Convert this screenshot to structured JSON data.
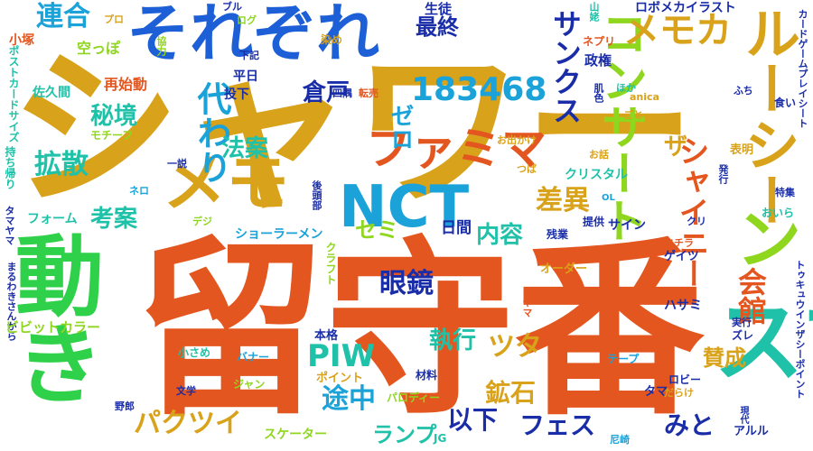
{
  "colors": {
    "orange": "#e4561f",
    "gold": "#d9a21b",
    "blue": "#1c5fd6",
    "sky": "#1ba3d9",
    "green": "#2fd14a",
    "lime": "#8fd61f",
    "teal": "#1fc2a8",
    "navy": "#1a2da8"
  },
  "words": [
    {
      "text": "留守番",
      "color": "orange"
    },
    {
      "text": "シャワー",
      "color": "gold"
    },
    {
      "text": "それぞれ",
      "color": "blue"
    },
    {
      "text": "動き",
      "color": "green"
    },
    {
      "text": "NCT",
      "color": "sky"
    },
    {
      "text": "ファミマ",
      "color": "orange"
    },
    {
      "text": "メモ",
      "color": "gold"
    },
    {
      "text": "ルーシー",
      "color": "gold"
    },
    {
      "text": "183468",
      "color": "sky"
    },
    {
      "text": "サンクス",
      "color": "navy"
    },
    {
      "text": "コンサート",
      "color": "lime"
    },
    {
      "text": "メモカ",
      "color": "gold"
    },
    {
      "text": "ザ",
      "color": "gold"
    },
    {
      "text": "ン",
      "color": "lime"
    },
    {
      "text": "シャイニー",
      "color": "orange"
    },
    {
      "text": "スマホ",
      "color": "teal"
    },
    {
      "text": "会館",
      "color": "orange"
    },
    {
      "text": "連合",
      "color": "sky"
    },
    {
      "text": "最終",
      "color": "navy"
    },
    {
      "text": "倉戸",
      "color": "navy"
    },
    {
      "text": "ゼロ",
      "color": "sky"
    },
    {
      "text": "秘境",
      "color": "teal"
    },
    {
      "text": "拡散",
      "color": "teal"
    },
    {
      "text": "代わり",
      "color": "sky"
    },
    {
      "text": "法案",
      "color": "teal"
    },
    {
      "text": "考案",
      "color": "teal"
    },
    {
      "text": "差異",
      "color": "gold"
    },
    {
      "text": "内容",
      "color": "teal"
    },
    {
      "text": "セミ",
      "color": "lime"
    },
    {
      "text": "眼鏡",
      "color": "navy"
    },
    {
      "text": "PIW",
      "color": "teal"
    },
    {
      "text": "執行",
      "color": "teal"
    },
    {
      "text": "ツタ",
      "color": "gold"
    },
    {
      "text": "鉱石",
      "color": "gold"
    },
    {
      "text": "途中",
      "color": "sky"
    },
    {
      "text": "以下",
      "color": "navy"
    },
    {
      "text": "フェス",
      "color": "navy"
    },
    {
      "text": "みと",
      "color": "navy"
    },
    {
      "text": "パクツイ",
      "color": "gold"
    },
    {
      "text": "ランプ",
      "color": "teal"
    },
    {
      "text": "賛成",
      "color": "gold"
    },
    {
      "text": "日間",
      "color": "navy"
    },
    {
      "text": "生徒",
      "color": "navy"
    },
    {
      "text": "山姥",
      "color": "teal"
    },
    {
      "text": "ロボメカイラスト",
      "color": "navy"
    },
    {
      "text": "ブル",
      "color": "navy"
    },
    {
      "text": "ログ",
      "color": "lime"
    },
    {
      "text": "プロ",
      "color": "gold"
    },
    {
      "text": "小塚",
      "color": "orange"
    },
    {
      "text": "空っぽ",
      "color": "lime"
    },
    {
      "text": "協力",
      "color": "lime"
    },
    {
      "text": "下記",
      "color": "navy"
    },
    {
      "text": "染め",
      "color": "gold"
    },
    {
      "text": "ネプリ",
      "color": "orange"
    },
    {
      "text": "政権",
      "color": "navy"
    },
    {
      "text": "平日",
      "color": "navy"
    },
    {
      "text": "投下",
      "color": "navy"
    },
    {
      "text": "四隅",
      "color": "navy"
    },
    {
      "text": "転売",
      "color": "orange"
    },
    {
      "text": "佐久間",
      "color": "teal"
    },
    {
      "text": "再始動",
      "color": "orange"
    },
    {
      "text": "モチーフ",
      "color": "lime"
    },
    {
      "text": "ポストカードサイズ",
      "color": "teal"
    },
    {
      "text": "持ち帰り",
      "color": "teal"
    },
    {
      "text": "タマヤマ",
      "color": "navy"
    },
    {
      "text": "フォーム",
      "color": "teal"
    },
    {
      "text": "ネロ",
      "color": "sky"
    },
    {
      "text": "後頭部",
      "color": "navy"
    },
    {
      "text": "デジ",
      "color": "lime"
    },
    {
      "text": "一説",
      "color": "navy"
    },
    {
      "text": "ショーラーメン",
      "color": "sky"
    },
    {
      "text": "クリスタル",
      "color": "teal"
    },
    {
      "text": "お出かけ",
      "color": "gold"
    },
    {
      "text": "つば",
      "color": "gold"
    },
    {
      "text": "肌色",
      "color": "navy"
    },
    {
      "text": "お話",
      "color": "gold"
    },
    {
      "text": "ほか",
      "color": "teal"
    },
    {
      "text": "ごと",
      "color": "gold"
    },
    {
      "text": "anica",
      "color": "gold"
    },
    {
      "text": "ふち",
      "color": "navy"
    },
    {
      "text": "食い",
      "color": "navy"
    },
    {
      "text": "カードゲームプレイシート",
      "color": "navy"
    },
    {
      "text": "表明",
      "color": "gold"
    },
    {
      "text": "特集",
      "color": "navy"
    },
    {
      "text": "おいら",
      "color": "teal"
    },
    {
      "text": "発行",
      "color": "navy"
    },
    {
      "text": "OL",
      "color": "sky"
    },
    {
      "text": "提供",
      "color": "navy"
    },
    {
      "text": "サイン",
      "color": "navy"
    },
    {
      "text": "クリ",
      "color": "navy"
    },
    {
      "text": "残業",
      "color": "navy"
    },
    {
      "text": "コチラ",
      "color": "orange"
    },
    {
      "text": "ゲイツ",
      "color": "navy"
    },
    {
      "text": "トゥキュウインザシーポイント",
      "color": "navy"
    },
    {
      "text": "オーダー",
      "color": "gold"
    },
    {
      "text": "ハサミ",
      "color": "navy"
    },
    {
      "text": "ヤマ",
      "color": "orange"
    },
    {
      "text": "クラフト",
      "color": "lime"
    },
    {
      "text": "まるわきさんから",
      "color": "navy"
    },
    {
      "text": "ビビットカラー",
      "color": "lime"
    },
    {
      "text": "本格",
      "color": "navy"
    },
    {
      "text": "ポイント",
      "color": "gold"
    },
    {
      "text": "小さめ",
      "color": "teal"
    },
    {
      "text": "バナー",
      "color": "sky"
    },
    {
      "text": "実行",
      "color": "navy"
    },
    {
      "text": "椎名",
      "color": "orange"
    },
    {
      "text": "ズレ",
      "color": "navy"
    },
    {
      "text": "テープ",
      "color": "sky"
    },
    {
      "text": "ロビー",
      "color": "navy"
    },
    {
      "text": "だらけ",
      "color": "gold"
    },
    {
      "text": "文学",
      "color": "navy"
    },
    {
      "text": "ジャン",
      "color": "lime"
    },
    {
      "text": "材料",
      "color": "navy"
    },
    {
      "text": "タマ",
      "color": "navy"
    },
    {
      "text": "パロディー",
      "color": "lime"
    },
    {
      "text": "野郎",
      "color": "navy"
    },
    {
      "text": "スケーター",
      "color": "lime"
    },
    {
      "text": "JG",
      "color": "teal"
    },
    {
      "text": "アルル",
      "color": "navy"
    },
    {
      "text": "現代",
      "color": "navy"
    },
    {
      "text": "尼崎",
      "color": "sky"
    }
  ]
}
